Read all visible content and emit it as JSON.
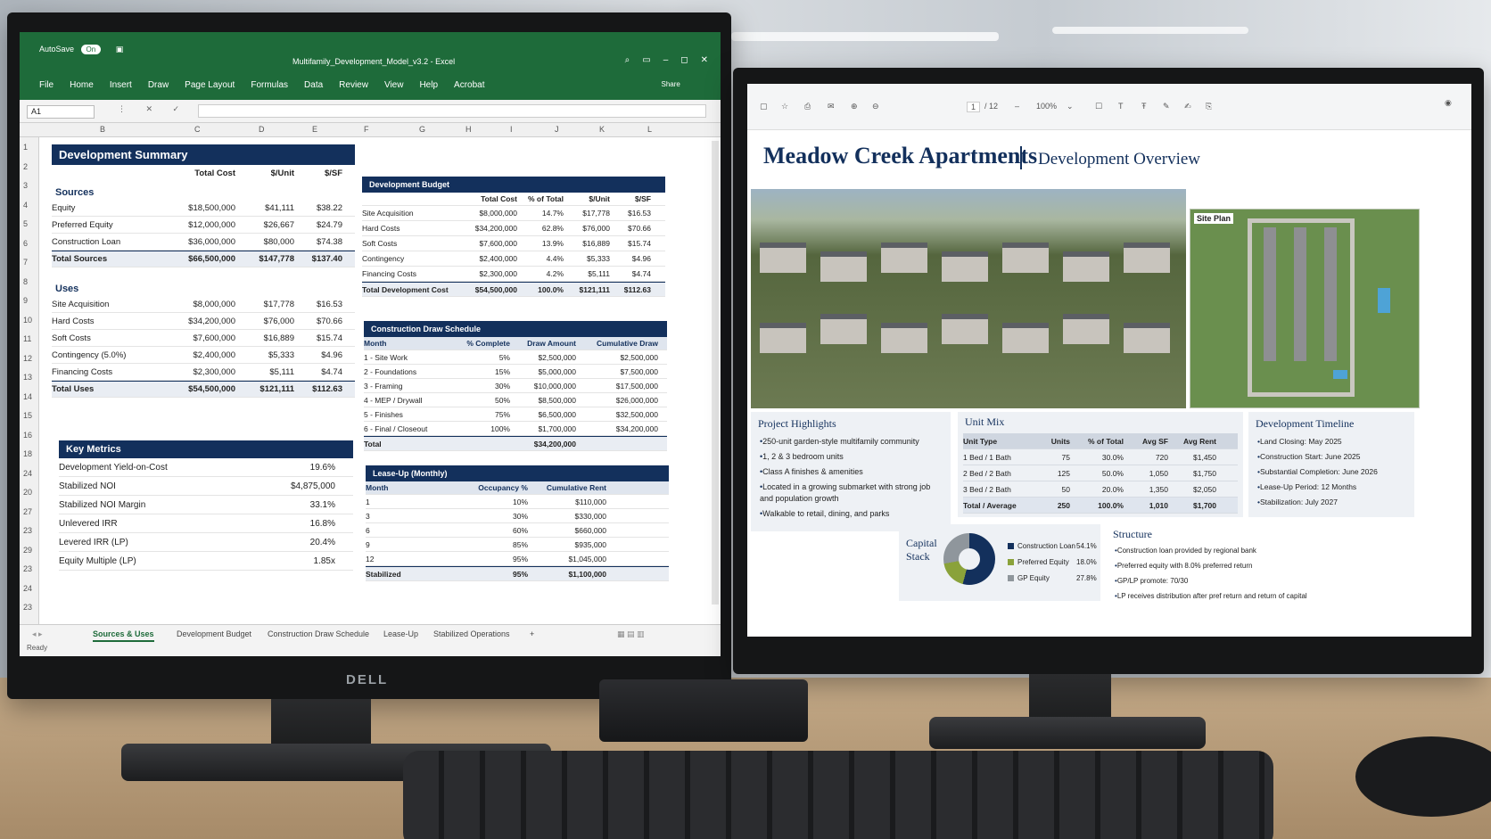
{
  "excel": {
    "autosave_label": "AutoSave",
    "autosave_state": "On",
    "title": "Multifamily_Development_Model_v3.2 - Excel",
    "menu": [
      "File",
      "Home",
      "Insert",
      "Draw",
      "Page Layout",
      "Formulas",
      "Data",
      "Review",
      "View",
      "Help",
      "Acrobat"
    ],
    "window_controls": [
      "⌕",
      "▭",
      "–",
      "◻",
      "✕"
    ],
    "share_label": "Share",
    "name_box": "A1",
    "fx_icons": "⋮ ✕ ✓ fx",
    "columns": [
      "B",
      "C",
      "D",
      "E",
      "F",
      "G",
      "H",
      "I",
      "J",
      "K",
      "L"
    ],
    "rows": [
      "1",
      "2",
      "3",
      "4",
      "5",
      "6",
      "7",
      "8",
      "9",
      "10",
      "11",
      "12",
      "13",
      "14",
      "15",
      "16",
      "18",
      "24",
      "20",
      "27",
      "23",
      "29",
      "23",
      "24",
      "23"
    ],
    "summary": {
      "title": "Development Summary",
      "col_total": "Total Cost",
      "col_unit": "$/Unit",
      "col_sf": "$/SF",
      "sources_label": "Sources",
      "sources": [
        [
          "Equity",
          "$18,500,000",
          "$41,111",
          "$38.22"
        ],
        [
          "Preferred Equity",
          "$12,000,000",
          "$26,667",
          "$24.79"
        ],
        [
          "Construction Loan",
          "$36,000,000",
          "$80,000",
          "$74.38"
        ]
      ],
      "sources_total": [
        "Total Sources",
        "$66,500,000",
        "$147,778",
        "$137.40"
      ],
      "uses_label": "Uses",
      "uses": [
        [
          "Site Acquisition",
          "$8,000,000",
          "$17,778",
          "$16.53"
        ],
        [
          "Hard Costs",
          "$34,200,000",
          "$76,000",
          "$70.66"
        ],
        [
          "Soft Costs",
          "$7,600,000",
          "$16,889",
          "$15.74"
        ],
        [
          "Contingency (5.0%)",
          "$2,400,000",
          "$5,333",
          "$4.96"
        ],
        [
          "Financing Costs",
          "$2,300,000",
          "$5,111",
          "$4.74"
        ]
      ],
      "uses_total": [
        "Total Uses",
        "$54,500,000",
        "$121,111",
        "$112.63"
      ]
    },
    "metrics": {
      "title": "Key Metrics",
      "items": [
        [
          "Development Yield-on-Cost",
          "19.6%"
        ],
        [
          "Stabilized NOI",
          "$4,875,000"
        ],
        [
          "Stabilized NOI Margin",
          "33.1%"
        ],
        [
          "Unlevered IRR",
          "16.8%"
        ],
        [
          "Levered IRR (LP)",
          "20.4%"
        ],
        [
          "Equity Multiple (LP)",
          "1.85x"
        ]
      ]
    },
    "budget": {
      "title": "Development Budget",
      "headers": [
        "",
        "Total Cost",
        "% of Total",
        "$/Unit",
        "$/SF"
      ],
      "rows": [
        [
          "Site Acquisition",
          "$8,000,000",
          "14.7%",
          "$17,778",
          "$16.53"
        ],
        [
          "Hard Costs",
          "$34,200,000",
          "62.8%",
          "$76,000",
          "$70.66"
        ],
        [
          "Soft Costs",
          "$7,600,000",
          "13.9%",
          "$16,889",
          "$15.74"
        ],
        [
          "Contingency",
          "$2,400,000",
          "4.4%",
          "$5,333",
          "$4.96"
        ],
        [
          "Financing Costs",
          "$2,300,000",
          "4.2%",
          "$5,111",
          "$4.74"
        ]
      ],
      "total": [
        "Total Development Cost",
        "$54,500,000",
        "100.0%",
        "$121,111",
        "$112.63"
      ]
    },
    "draw": {
      "title": "Construction Draw Schedule",
      "headers": [
        "Month",
        "% Complete",
        "Draw Amount",
        "Cumulative Draw"
      ],
      "rows": [
        [
          "1 - Site Work",
          "5%",
          "$2,500,000",
          "$2,500,000"
        ],
        [
          "2 - Foundations",
          "15%",
          "$5,000,000",
          "$7,500,000"
        ],
        [
          "3 - Framing",
          "30%",
          "$10,000,000",
          "$17,500,000"
        ],
        [
          "4 - MEP / Drywall",
          "50%",
          "$8,500,000",
          "$26,000,000"
        ],
        [
          "5 - Finishes",
          "75%",
          "$6,500,000",
          "$32,500,000"
        ],
        [
          "6 - Final / Closeout",
          "100%",
          "$1,700,000",
          "$34,200,000"
        ]
      ],
      "total": [
        "Total",
        "",
        "$34,200,000",
        ""
      ]
    },
    "leaseup": {
      "title": "Lease-Up (Monthly)",
      "headers": [
        "Month",
        "Occupancy %",
        "Cumulative Rent"
      ],
      "rows": [
        [
          "1",
          "10%",
          "$110,000"
        ],
        [
          "3",
          "30%",
          "$330,000"
        ],
        [
          "6",
          "60%",
          "$660,000"
        ],
        [
          "9",
          "85%",
          "$935,000"
        ],
        [
          "12",
          "95%",
          "$1,045,000"
        ]
      ],
      "total": [
        "Stabilized",
        "95%",
        "$1,100,000"
      ]
    },
    "sheet_tabs": [
      "Sources & Uses",
      "Development Budget",
      "Construction Draw Schedule",
      "Lease-Up",
      "Stabilized Operations",
      "+"
    ],
    "status": "Ready"
  },
  "monitor_brand": "DELL",
  "pdf": {
    "page_current": "1",
    "page_total": "/ 12",
    "zoom": "100%",
    "title": "Meadow Creek Apartments",
    "subtitle": "Development Overview",
    "site_plan_label": "Site Plan",
    "highlights": {
      "title": "Project Highlights",
      "items": [
        "250-unit garden-style multifamily community",
        "1, 2 & 3 bedroom units",
        "Class A finishes & amenities",
        "Located in a growing submarket with strong job and population growth",
        "Walkable to retail, dining, and parks"
      ]
    },
    "unit_mix": {
      "title": "Unit Mix",
      "headers": [
        "Unit Type",
        "Units",
        "% of Total",
        "Avg SF",
        "Avg Rent"
      ],
      "rows": [
        [
          "1 Bed / 1 Bath",
          "75",
          "30.0%",
          "720",
          "$1,450"
        ],
        [
          "2 Bed / 2 Bath",
          "125",
          "50.0%",
          "1,050",
          "$1,750"
        ],
        [
          "3 Bed / 2 Bath",
          "50",
          "20.0%",
          "1,350",
          "$2,050"
        ]
      ],
      "total": [
        "Total / Average",
        "250",
        "100.0%",
        "1,010",
        "$1,700"
      ]
    },
    "timeline": {
      "title": "Development Timeline",
      "items": [
        "Land Closing: May 2025",
        "Construction Start: June 2025",
        "Substantial Completion: June 2026",
        "Lease-Up Period: 12 Months",
        "Stabilization: July 2027"
      ]
    },
    "capital_stack": {
      "title_line1": "Capital",
      "title_line2": "Stack",
      "items": [
        {
          "name": "Construction Loan",
          "pct": "54.1%",
          "color": "#13305c",
          "value": 54.1
        },
        {
          "name": "Preferred Equity",
          "pct": "18.0%",
          "color": "#8aa23a",
          "value": 18.0
        },
        {
          "name": "GP Equity",
          "pct": "27.8%",
          "color": "#8f969c",
          "value": 27.8
        }
      ]
    },
    "structure": {
      "title": "Structure",
      "items": [
        "Construction loan provided by regional bank",
        "Preferred equity with 8.0% preferred return",
        "GP/LP promote: 70/30",
        "LP receives distribution after pref return and return of capital"
      ]
    }
  }
}
